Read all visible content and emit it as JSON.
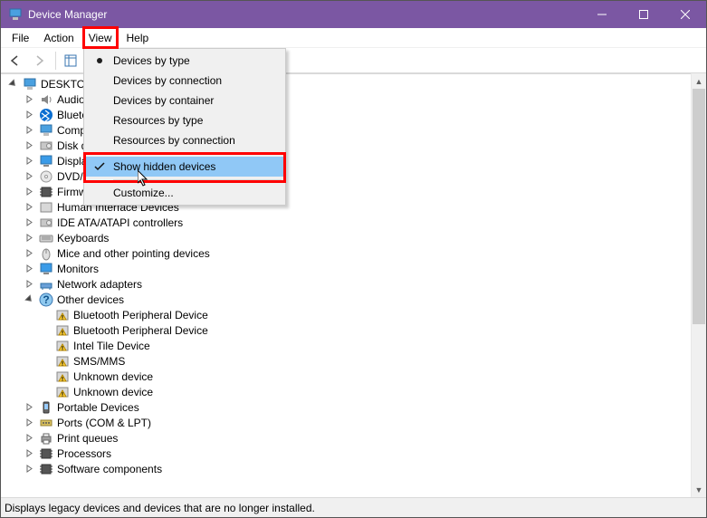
{
  "window": {
    "title": "Device Manager"
  },
  "menubar": {
    "file": "File",
    "action": "Action",
    "view": "View",
    "help": "Help"
  },
  "dropdown": {
    "items": [
      {
        "label": "Devices by type",
        "bullet": true
      },
      {
        "label": "Devices by connection"
      },
      {
        "label": "Devices by container"
      },
      {
        "label": "Resources by type"
      },
      {
        "label": "Resources by connection"
      }
    ],
    "show_hidden": "Show hidden devices",
    "customize": "Customize..."
  },
  "tree": {
    "root": "DESKTOP",
    "categories": [
      {
        "label": "Audio"
      },
      {
        "label": "Bluetooth"
      },
      {
        "label": "Computer"
      },
      {
        "label": "Disk drives"
      },
      {
        "label": "Display adapters"
      },
      {
        "label": "DVD/CD drives"
      },
      {
        "label": "Firmware"
      },
      {
        "label": "Human Interface Devices"
      },
      {
        "label": "IDE ATA/ATAPI controllers"
      },
      {
        "label": "Keyboards"
      },
      {
        "label": "Mice and other pointing devices"
      },
      {
        "label": "Monitors"
      },
      {
        "label": "Network adapters"
      },
      {
        "label": "Other devices",
        "expanded": true,
        "children": [
          "Bluetooth Peripheral Device",
          "Bluetooth Peripheral Device",
          "Intel Tile Device",
          "SMS/MMS",
          "Unknown device",
          "Unknown device"
        ]
      },
      {
        "label": "Portable Devices"
      },
      {
        "label": "Ports (COM & LPT)"
      },
      {
        "label": "Print queues"
      },
      {
        "label": "Processors"
      },
      {
        "label": "Software components"
      }
    ]
  },
  "statusbar": {
    "text": "Displays legacy devices and devices that are no longer installed."
  }
}
